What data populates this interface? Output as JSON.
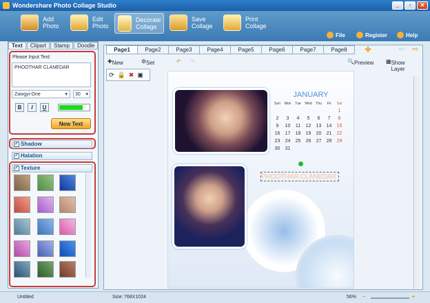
{
  "app": {
    "title": "Wondershare Photo Collage Studio",
    "window_buttons": [
      "_",
      "▫",
      "✕"
    ]
  },
  "toolbar": {
    "add_photo": "Add Photo",
    "edit_photo": "Edit Photo",
    "decorate_collage": "Decorate Collage",
    "save_collage": "Save Collage",
    "print_collage": "Print Collage"
  },
  "menu": {
    "file": "File",
    "register": "Register",
    "help": "Help"
  },
  "panel": {
    "tabs": [
      "Text",
      "Clipart",
      "Stamp",
      "Doodle"
    ],
    "input_label": "Please Input Text:",
    "input_value": "PHOOTHAR CLANEDAR",
    "font": "Zawgyi-One",
    "size": "30",
    "bold": "B",
    "italic": "I",
    "underline": "U",
    "text_color": "#22d81f",
    "new_text": "New Text",
    "shadow": "Shadow",
    "halation": "Halation",
    "texture": "Texture"
  },
  "pages": [
    "Page1",
    "Page2",
    "Page3",
    "Page4",
    "Page5",
    "Page6",
    "Page7",
    "Page8"
  ],
  "actions": {
    "new": "New",
    "set": "Set",
    "preview": "Preview",
    "show_layer": "Show Layer"
  },
  "calendar": {
    "month": "JANUARY",
    "days": [
      "Sun",
      "Mon",
      "Tue",
      "Wed",
      "Thu",
      "Fri",
      "Sat"
    ],
    "weeks": [
      [
        "",
        "",
        "",
        "",
        "",
        "",
        "1"
      ],
      [
        "2",
        "3",
        "4",
        "5",
        "6",
        "7",
        "8"
      ],
      [
        "9",
        "10",
        "11",
        "12",
        "13",
        "14",
        "15"
      ],
      [
        "16",
        "17",
        "18",
        "19",
        "20",
        "21",
        "22"
      ],
      [
        "23",
        "24",
        "25",
        "26",
        "27",
        "28",
        "29"
      ],
      [
        "30",
        "31",
        "",
        "",
        "",
        "",
        ""
      ]
    ]
  },
  "canvas_text": "PHOOTHAR CLANEDAR",
  "status": {
    "file": "Untitled",
    "size_label": "Size:",
    "size": "768X1024",
    "zoom": "56%",
    "minus": "−",
    "plus": "+"
  }
}
